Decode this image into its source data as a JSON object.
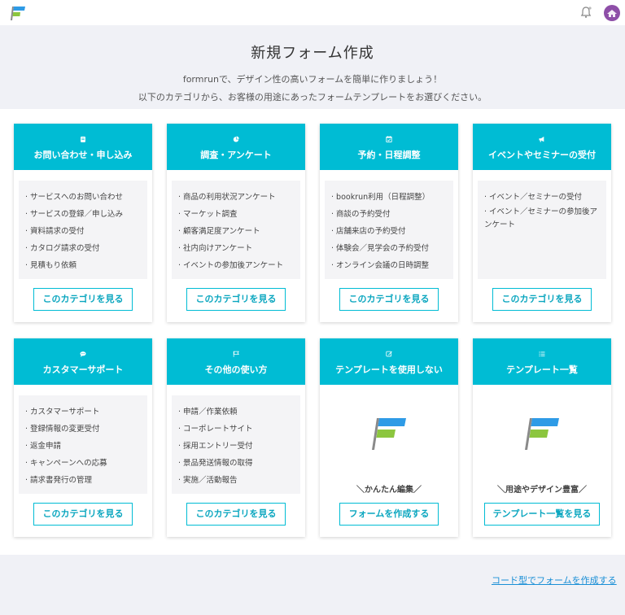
{
  "header": {
    "title": "新規フォーム作成",
    "subtitle1": "formrunで、デザイン性の高いフォームを簡単に作りましょう！",
    "subtitle2": "以下のカテゴリから、お客様の用途にあったフォームテンプレートをお選びください。"
  },
  "cards": [
    {
      "icon": "book-icon",
      "title": "お問い合わせ・申し込み",
      "items": [
        "サービスへのお問い合わせ",
        "サービスの登録／申し込み",
        "資料請求の受付",
        "カタログ請求の受付",
        "見積もり依頼"
      ],
      "button": "このカテゴリを見る"
    },
    {
      "icon": "pie-chart-icon",
      "title": "調査・アンケート",
      "items": [
        "商品の利用状況アンケート",
        "マーケット調査",
        "顧客満足度アンケート",
        "社内向けアンケート",
        "イベントの参加後アンケート"
      ],
      "button": "このカテゴリを見る"
    },
    {
      "icon": "calendar-check-icon",
      "title": "予約・日程調整",
      "items": [
        "bookrun利用（日程調整）",
        "商談の予約受付",
        "店舗来店の予約受付",
        "体験会／見学会の予約受付",
        "オンライン会議の日時調整"
      ],
      "button": "このカテゴリを見る"
    },
    {
      "icon": "megaphone-icon",
      "title": "イベントやセミナーの受付",
      "items": [
        "イベント／セミナーの受付",
        "イベント／セミナーの参加後アンケート"
      ],
      "button": "このカテゴリを見る"
    },
    {
      "icon": "chat-bubble-icon",
      "title": "カスタマーサポート",
      "items": [
        "カスタマーサポート",
        "登録情報の変更受付",
        "返金申請",
        "キャンペーンへの応募",
        "請求書発行の管理"
      ],
      "button": "このカテゴリを見る"
    },
    {
      "icon": "flag-icon",
      "title": "その他の使い方",
      "items": [
        "申請／作業依頼",
        "コーポレートサイト",
        "採用エントリー受付",
        "景品発送情報の取得",
        "実施／活動報告"
      ],
      "button": "このカテゴリを見る"
    },
    {
      "icon": "edit-icon",
      "title": "テンプレートを使用しない",
      "tagline": "＼かんたん編集／",
      "button": "フォームを作成する"
    },
    {
      "icon": "list-icon",
      "title": "テンプレート一覧",
      "tagline": "＼用途やデザイン豊富／",
      "button": "テンプレート一覧を見る"
    }
  ],
  "footer": {
    "link": "コード型でフォームを作成する"
  },
  "colors": {
    "accent": "#00bcd4",
    "logo_blue": "#2e9be6",
    "logo_green": "#8cc63f",
    "link": "#1a8fd6"
  }
}
